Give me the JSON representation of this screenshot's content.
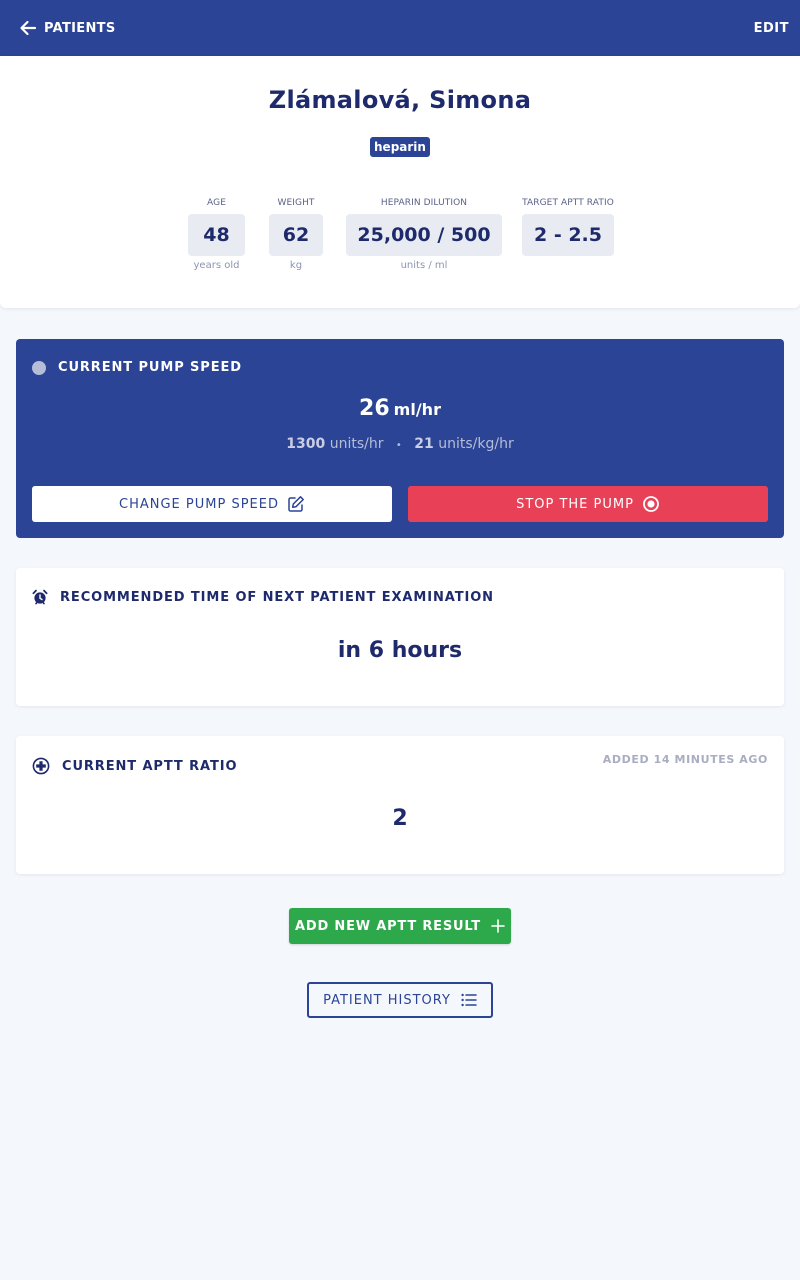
{
  "header": {
    "back_label": "PATIENTS",
    "edit_label": "EDIT"
  },
  "patient": {
    "name": "Zlámalová, Simona",
    "drug_badge": "heparin",
    "stats": [
      {
        "label": "AGE",
        "value": "48",
        "unit": "years old"
      },
      {
        "label": "WEIGHT",
        "value": "62",
        "unit": "kg"
      },
      {
        "label": "HEPARIN DILUTION",
        "value": "25,000 / 500",
        "unit": "units / ml"
      },
      {
        "label": "TARGET APTT RATIO",
        "value": "2 - 2.5",
        "unit": ""
      }
    ]
  },
  "pump": {
    "title": "CURRENT PUMP SPEED",
    "speed_value": "26",
    "speed_unit": "ml/hr",
    "units_hr_value": "1300",
    "units_hr_label": "units/hr",
    "units_kg_value": "21",
    "units_kg_label": "units/kg/hr",
    "separator": "•",
    "change_label": "CHANGE PUMP SPEED",
    "stop_label": "STOP THE PUMP"
  },
  "examination": {
    "title": "RECOMMENDED TIME OF NEXT PATIENT EXAMINATION",
    "value": "in 6 hours"
  },
  "aptt": {
    "title": "CURRENT APTT RATIO",
    "added_note": "ADDED 14 MINUTES AGO",
    "value": "2"
  },
  "actions": {
    "add_label": "ADD NEW APTT RESULT",
    "history_label": "PATIENT HISTORY"
  },
  "colors": {
    "primary": "#2b4495",
    "danger": "#e84057",
    "success": "#2da84a",
    "background": "#f4f7fc"
  },
  "icons": {
    "back": "arrow-left-icon",
    "pump_status": "status-dot-icon",
    "edit": "edit-icon",
    "stop": "stop-record-icon",
    "alarm": "alarm-clock-icon",
    "medical": "medical-cross-icon",
    "plus": "plus-icon",
    "list": "list-icon"
  }
}
